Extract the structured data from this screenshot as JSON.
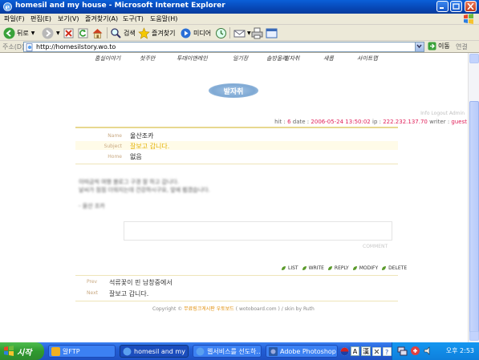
{
  "window": {
    "title": "homesil and my house - Microsoft Internet Explorer"
  },
  "menubar": {
    "items": [
      "파일(F)",
      "편집(E)",
      "보기(V)",
      "즐겨찾기(A)",
      "도구(T)",
      "도움말(H)"
    ]
  },
  "toolbar": {
    "back_label": "뒤로",
    "search_label": "검색",
    "favorites_label": "즐겨찾기",
    "media_label": "미디어"
  },
  "addressbar": {
    "label": "주소(D)",
    "url": "http://homesilstory.wo.to",
    "go_label": "이동",
    "links_label": "연결"
  },
  "page": {
    "nav_items": [
      "홈실이야기",
      "첫주만",
      "투데이앤레인",
      "일기장",
      "솔방울리",
      "발자취",
      "새롭",
      "사이트맵"
    ],
    "badge_label": "발자취",
    "login_links": "Info Logout Admin",
    "meta": {
      "hit_label": "hit :",
      "hit_value": "6",
      "date_label": "date :",
      "date_value": "2006-05-24 13:50:02",
      "ip_label": "ip :",
      "ip_value": "222.232.137.70",
      "writer_label": "writer :",
      "writer_value": "guest"
    },
    "fields": {
      "name_label": "Name",
      "name_value": "울산조카",
      "subject_label": "Subject",
      "subject_value": "잘보고 갑니다.",
      "home_label": "Home",
      "home_value": "없음"
    },
    "body_lines": [
      "이따금씩 여행 블로그 구경 잘 하고 갑니다.",
      "날씨가 점점 더워지는데 건강하시구요, 앞에 뵙겠습니다.",
      "- 울산 조카"
    ],
    "comment_button": "COMMENT",
    "actions": [
      "LIST",
      "WRITE",
      "REPLY",
      "MODIFY",
      "DELETE"
    ],
    "prev_label": "Prev",
    "prev_title": "석류꽃이 핀 남창중에서",
    "next_label": "Next",
    "next_title": "잘보고 갑니다.",
    "copyright_prefix": "Copyright ©",
    "copyright_link": "무료링크게시판 우토보드",
    "copyright_suffix": "( wotoboard.com ) / skin by Ruth"
  },
  "taskbar": {
    "start_label": "시작",
    "tasks": [
      "알FTP",
      "homesil and my ...",
      "웹서비스를 선도하...",
      "Adobe Photoshop"
    ],
    "ime_labels": [
      "A",
      "漢"
    ],
    "clock": "오후 2:53"
  },
  "colors": {
    "title_bar": "#0747b5",
    "chrome": "#ece9d8",
    "taskbar": "#225ed5",
    "start_button": "#2f9a2f",
    "accent_pink": "#e0205a",
    "divider_gold": "#e7d88f"
  }
}
